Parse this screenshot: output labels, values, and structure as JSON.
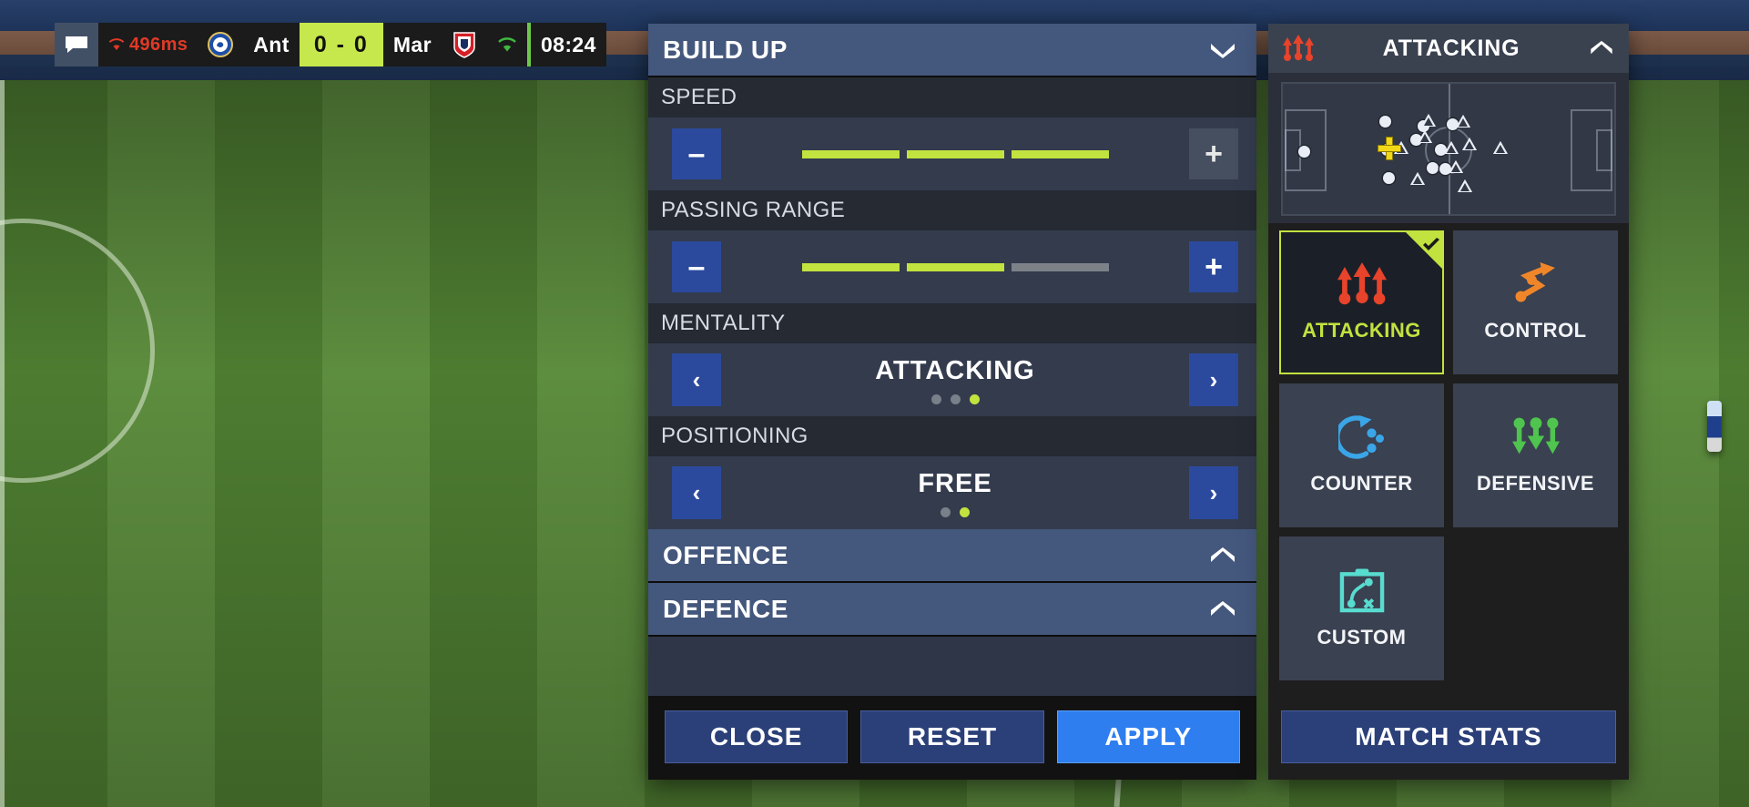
{
  "scoreboard": {
    "chat_icon": "chat-bubble-icon",
    "ping": "496ms",
    "ping_icon": "wifi-icon",
    "home_crest_icon": "chelsea-crest-icon",
    "home_team": "Ant",
    "score": "0 - 0",
    "away_team": "Mar",
    "away_crest_icon": "stoke-crest-icon",
    "connection_icon": "wifi-icon",
    "clock": "08:24"
  },
  "tactics_panel": {
    "build_up": {
      "title": "BUILD UP",
      "collapse_icon": "chevron-down-icon",
      "expanded": true,
      "sliders": [
        {
          "label": "SPEED",
          "decrement_label": "–",
          "increment_label": "+",
          "decrement_icon": "minus-icon",
          "increment_icon": "plus-icon",
          "decrement_enabled": true,
          "increment_enabled": false,
          "segments_total": 3,
          "segments_filled": 3
        },
        {
          "label": "PASSING RANGE",
          "decrement_label": "–",
          "increment_label": "+",
          "decrement_icon": "minus-icon",
          "increment_icon": "plus-icon",
          "decrement_enabled": true,
          "increment_enabled": true,
          "segments_total": 3,
          "segments_filled": 2
        }
      ],
      "choices": [
        {
          "label": "MENTALITY",
          "value": "ATTACKING",
          "prev_label": "‹",
          "next_label": "›",
          "prev_icon": "chevron-left-icon",
          "next_icon": "chevron-right-icon",
          "dots_total": 3,
          "dots_active_index": 2
        },
        {
          "label": "POSITIONING",
          "value": "FREE",
          "prev_label": "‹",
          "next_label": "›",
          "prev_icon": "chevron-left-icon",
          "next_icon": "chevron-right-icon",
          "dots_total": 2,
          "dots_active_index": 1
        }
      ]
    },
    "offence": {
      "title": "OFFENCE",
      "collapse_icon": "chevron-up-icon",
      "expanded": false
    },
    "defence": {
      "title": "DEFENCE",
      "collapse_icon": "chevron-up-icon",
      "expanded": false
    },
    "footer": {
      "close_label": "CLOSE",
      "reset_label": "RESET",
      "apply_label": "APPLY"
    }
  },
  "preset_panel": {
    "header": {
      "icon": "attacking-arrows-icon",
      "title": "ATTACKING",
      "collapse_icon": "chevron-up-icon"
    },
    "minimap": {
      "name": "formation-minimap",
      "cursor_icon": "crosshair-cursor-icon",
      "team_dots": 11,
      "opponent_triangles": 11
    },
    "presets": [
      {
        "label": "ATTACKING",
        "icon": "attacking-arrows-icon",
        "icon_color": "#e8432b",
        "selected": true,
        "check_icon": "check-icon"
      },
      {
        "label": "CONTROL",
        "icon": "control-zigzag-icon",
        "icon_color": "#f0862a",
        "selected": false
      },
      {
        "label": "COUNTER",
        "icon": "counter-arc-icon",
        "icon_color": "#3aa6e8",
        "selected": false
      },
      {
        "label": "DEFENSIVE",
        "icon": "defensive-arrows-icon",
        "icon_color": "#4fc44f",
        "selected": false
      },
      {
        "label": "CUSTOM",
        "icon": "clipboard-tactics-icon",
        "icon_color": "#58dcd0",
        "selected": false
      }
    ],
    "match_stats_label": "MATCH STATS"
  },
  "colors": {
    "accent_green": "#c2e23f",
    "primary_blue": "#2b4a9e",
    "apply_blue": "#2e7ef0",
    "header_blue": "#44577c",
    "ping_red": "#e03a27"
  }
}
